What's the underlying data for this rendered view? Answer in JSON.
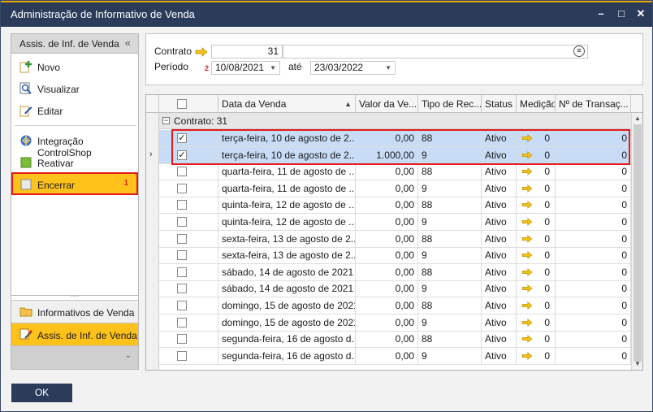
{
  "window": {
    "title": "Administração de Informativo de Venda"
  },
  "left_panel": {
    "header": "Assis. de Inf. de Venda",
    "collapse_glyph": "«",
    "actions": [
      {
        "label": "Novo",
        "icon": "add-icon"
      },
      {
        "label": "Visualizar",
        "icon": "magnifier-icon"
      },
      {
        "label": "Editar",
        "icon": "pencil-icon"
      },
      {
        "label": "Integração ControlShop",
        "icon": "integration-icon"
      },
      {
        "label": "Reativar",
        "icon": "green-square-icon"
      },
      {
        "label": "Encerrar",
        "icon": "gray-square-icon",
        "badge": "1"
      }
    ],
    "nav": [
      {
        "label": "Informativos de Venda",
        "icon": "folder-icon"
      },
      {
        "label": "Assis. de Inf. de Venda",
        "icon": "wizard-icon"
      }
    ]
  },
  "filter": {
    "contrato_label": "Contrato",
    "contrato_value": "31",
    "periodo_label": "Período",
    "periodo_required": "2",
    "periodo_from": "10/08/2021",
    "ate_label": "até",
    "periodo_to": "23/03/2022"
  },
  "grid": {
    "columns": [
      "",
      "Data da Venda",
      "Valor da Ve...",
      "Tipo de Rec...",
      "Status",
      "Medição",
      "Nº de Transaç..."
    ],
    "group_label": "Contrato: 31",
    "rows": [
      {
        "checked": true,
        "data": "terça-feira, 10 de agosto de 2...",
        "valor": "0,00",
        "tipo": "88",
        "status": "Ativo",
        "medicao": "0",
        "transacoes": "0"
      },
      {
        "checked": true,
        "data": "terça-feira, 10 de agosto de 2...",
        "valor": "1.000,00",
        "tipo": "9",
        "status": "Ativo",
        "medicao": "0",
        "transacoes": "0"
      },
      {
        "checked": false,
        "data": "quarta-feira, 11 de agosto de ...",
        "valor": "0,00",
        "tipo": "88",
        "status": "Ativo",
        "medicao": "0",
        "transacoes": "0"
      },
      {
        "checked": false,
        "data": "quarta-feira, 11 de agosto de ...",
        "valor": "0,00",
        "tipo": "9",
        "status": "Ativo",
        "medicao": "0",
        "transacoes": "0"
      },
      {
        "checked": false,
        "data": "quinta-feira, 12 de agosto de ...",
        "valor": "0,00",
        "tipo": "88",
        "status": "Ativo",
        "medicao": "0",
        "transacoes": "0"
      },
      {
        "checked": false,
        "data": "quinta-feira, 12 de agosto de ...",
        "valor": "0,00",
        "tipo": "9",
        "status": "Ativo",
        "medicao": "0",
        "transacoes": "0"
      },
      {
        "checked": false,
        "data": "sexta-feira, 13 de agosto de 2...",
        "valor": "0,00",
        "tipo": "88",
        "status": "Ativo",
        "medicao": "0",
        "transacoes": "0"
      },
      {
        "checked": false,
        "data": "sexta-feira, 13 de agosto de 2...",
        "valor": "0,00",
        "tipo": "9",
        "status": "Ativo",
        "medicao": "0",
        "transacoes": "0"
      },
      {
        "checked": false,
        "data": "sábado, 14 de agosto de 2021",
        "valor": "0,00",
        "tipo": "88",
        "status": "Ativo",
        "medicao": "0",
        "transacoes": "0"
      },
      {
        "checked": false,
        "data": "sábado, 14 de agosto de 2021",
        "valor": "0,00",
        "tipo": "9",
        "status": "Ativo",
        "medicao": "0",
        "transacoes": "0"
      },
      {
        "checked": false,
        "data": "domingo, 15 de agosto de 2021",
        "valor": "0,00",
        "tipo": "88",
        "status": "Ativo",
        "medicao": "0",
        "transacoes": "0"
      },
      {
        "checked": false,
        "data": "domingo, 15 de agosto de 2021",
        "valor": "0,00",
        "tipo": "9",
        "status": "Ativo",
        "medicao": "0",
        "transacoes": "0"
      },
      {
        "checked": false,
        "data": "segunda-feira, 16 de agosto d...",
        "valor": "0,00",
        "tipo": "88",
        "status": "Ativo",
        "medicao": "0",
        "transacoes": "0"
      },
      {
        "checked": false,
        "data": "segunda-feira, 16 de agosto d...",
        "valor": "0,00",
        "tipo": "9",
        "status": "Ativo",
        "medicao": "0",
        "transacoes": "0"
      }
    ]
  },
  "footer": {
    "ok_label": "OK"
  },
  "colors": {
    "titlebar": "#2b3c5b",
    "accent": "#ffc21a",
    "highlight": "#e31b1b",
    "row_selected": "#c8dcf5"
  }
}
